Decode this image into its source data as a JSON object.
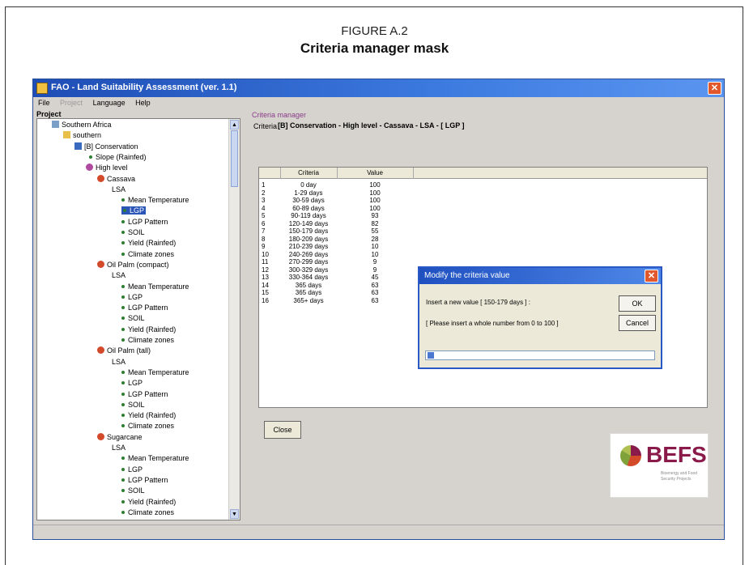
{
  "figure": {
    "label": "FIGURE A.2",
    "title": "Criteria manager mask"
  },
  "window": {
    "title": "FAO - Land Suitability Assessment (ver. 1.1)",
    "menu": [
      {
        "label": "File",
        "disabled": false
      },
      {
        "label": "Project",
        "disabled": true
      },
      {
        "label": "Language",
        "disabled": false
      },
      {
        "label": "Help",
        "disabled": false
      }
    ]
  },
  "tree": {
    "header": "Project",
    "nodes": [
      {
        "label": "Southern Africa",
        "icon": "grid"
      },
      {
        "label": "southern",
        "icon": "folder"
      },
      {
        "label": "[B] Conservation",
        "icon": "book"
      },
      {
        "label": "Slope (Rainfed)",
        "icon": "dot"
      },
      {
        "label": "High level",
        "icon": "circle"
      },
      {
        "label": "Cassava",
        "icon": "plant"
      },
      {
        "label": "LSA",
        "icon": "none"
      },
      {
        "label": "Mean Temperature",
        "icon": "dot"
      },
      {
        "label": "LGP",
        "icon": "dot",
        "selected": true
      },
      {
        "label": "LGP Pattern",
        "icon": "dot"
      },
      {
        "label": "SOIL",
        "icon": "dot"
      },
      {
        "label": "Yield (Rainfed)",
        "icon": "dot"
      },
      {
        "label": "Climate zones",
        "icon": "dot"
      },
      {
        "label": "Oil Palm (compact)",
        "icon": "plant"
      },
      {
        "label": "LSA",
        "icon": "none"
      },
      {
        "label": "Mean Temperature",
        "icon": "dot"
      },
      {
        "label": "LGP",
        "icon": "dot"
      },
      {
        "label": "LGP Pattern",
        "icon": "dot"
      },
      {
        "label": "SOIL",
        "icon": "dot"
      },
      {
        "label": "Yield (Rainfed)",
        "icon": "dot"
      },
      {
        "label": "Climate zones",
        "icon": "dot"
      },
      {
        "label": "Oil Palm (tall)",
        "icon": "plant"
      },
      {
        "label": "LSA",
        "icon": "none"
      },
      {
        "label": "Mean Temperature",
        "icon": "dot"
      },
      {
        "label": "LGP",
        "icon": "dot"
      },
      {
        "label": "LGP Pattern",
        "icon": "dot"
      },
      {
        "label": "SOIL",
        "icon": "dot"
      },
      {
        "label": "Yield (Rainfed)",
        "icon": "dot"
      },
      {
        "label": "Climate zones",
        "icon": "dot"
      },
      {
        "label": "Sugarcane",
        "icon": "plant"
      },
      {
        "label": "LSA",
        "icon": "none"
      },
      {
        "label": "Mean Temperature",
        "icon": "dot"
      },
      {
        "label": "LGP",
        "icon": "dot"
      },
      {
        "label": "LGP Pattern",
        "icon": "dot"
      },
      {
        "label": "SOIL",
        "icon": "dot"
      },
      {
        "label": "Yield (Rainfed)",
        "icon": "dot"
      },
      {
        "label": "Climate zones",
        "icon": "dot"
      }
    ]
  },
  "criteria_manager": {
    "header": "Criteria manager",
    "criteria_label": "Criteria",
    "criteria_value": "[B] Conservation - High level - Cassava - LSA - [ LGP ]",
    "columns": [
      "Criteria",
      "Value"
    ],
    "rows": [
      {
        "n": "1",
        "criteria": "0 day",
        "value": "100"
      },
      {
        "n": "2",
        "criteria": "1-29 days",
        "value": "100"
      },
      {
        "n": "3",
        "criteria": "30-59 days",
        "value": "100"
      },
      {
        "n": "4",
        "criteria": "60-89 days",
        "value": "100"
      },
      {
        "n": "5",
        "criteria": "90-119 days",
        "value": "93"
      },
      {
        "n": "6",
        "criteria": "120-149 days",
        "value": "82"
      },
      {
        "n": "7",
        "criteria": "150-179 days",
        "value": "55"
      },
      {
        "n": "8",
        "criteria": "180-209 days",
        "value": "28"
      },
      {
        "n": "9",
        "criteria": "210-239 days",
        "value": "10"
      },
      {
        "n": "10",
        "criteria": "240-269 days",
        "value": "10"
      },
      {
        "n": "11",
        "criteria": "270-299 days",
        "value": "9"
      },
      {
        "n": "12",
        "criteria": "300-329 days",
        "value": "9"
      },
      {
        "n": "13",
        "criteria": "330-364 days",
        "value": "45"
      },
      {
        "n": "14",
        "criteria": "365 days",
        "value": "63"
      },
      {
        "n": "15",
        "criteria": "365 days",
        "value": "63"
      },
      {
        "n": "16",
        "criteria": "365+ days",
        "value": "63"
      }
    ],
    "close_label": "Close"
  },
  "dialog": {
    "title": "Modify the criteria value",
    "prompt": "Insert a new value [ 150-179 days ] :",
    "hint": "[ Please insert a whole number from 0 to 100 ]",
    "ok_label": "OK",
    "cancel_label": "Cancel",
    "input_value": ""
  },
  "logo": {
    "text": "BEFS",
    "subtitle": "Bioenergy and Food Security Projects"
  }
}
